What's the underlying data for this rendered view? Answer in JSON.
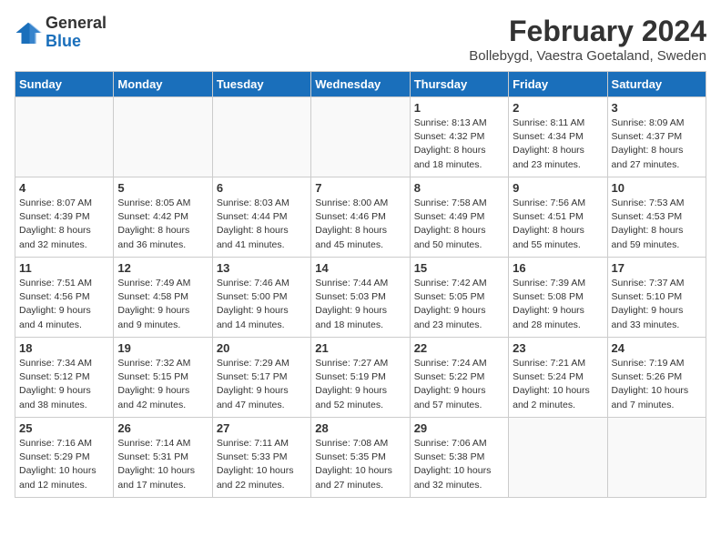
{
  "logo": {
    "general": "General",
    "blue": "Blue"
  },
  "header": {
    "month": "February 2024",
    "location": "Bollebygd, Vaestra Goetaland, Sweden"
  },
  "weekdays": [
    "Sunday",
    "Monday",
    "Tuesday",
    "Wednesday",
    "Thursday",
    "Friday",
    "Saturday"
  ],
  "weeks": [
    [
      {
        "day": "",
        "info": ""
      },
      {
        "day": "",
        "info": ""
      },
      {
        "day": "",
        "info": ""
      },
      {
        "day": "",
        "info": ""
      },
      {
        "day": "1",
        "info": "Sunrise: 8:13 AM\nSunset: 4:32 PM\nDaylight: 8 hours\nand 18 minutes."
      },
      {
        "day": "2",
        "info": "Sunrise: 8:11 AM\nSunset: 4:34 PM\nDaylight: 8 hours\nand 23 minutes."
      },
      {
        "day": "3",
        "info": "Sunrise: 8:09 AM\nSunset: 4:37 PM\nDaylight: 8 hours\nand 27 minutes."
      }
    ],
    [
      {
        "day": "4",
        "info": "Sunrise: 8:07 AM\nSunset: 4:39 PM\nDaylight: 8 hours\nand 32 minutes."
      },
      {
        "day": "5",
        "info": "Sunrise: 8:05 AM\nSunset: 4:42 PM\nDaylight: 8 hours\nand 36 minutes."
      },
      {
        "day": "6",
        "info": "Sunrise: 8:03 AM\nSunset: 4:44 PM\nDaylight: 8 hours\nand 41 minutes."
      },
      {
        "day": "7",
        "info": "Sunrise: 8:00 AM\nSunset: 4:46 PM\nDaylight: 8 hours\nand 45 minutes."
      },
      {
        "day": "8",
        "info": "Sunrise: 7:58 AM\nSunset: 4:49 PM\nDaylight: 8 hours\nand 50 minutes."
      },
      {
        "day": "9",
        "info": "Sunrise: 7:56 AM\nSunset: 4:51 PM\nDaylight: 8 hours\nand 55 minutes."
      },
      {
        "day": "10",
        "info": "Sunrise: 7:53 AM\nSunset: 4:53 PM\nDaylight: 8 hours\nand 59 minutes."
      }
    ],
    [
      {
        "day": "11",
        "info": "Sunrise: 7:51 AM\nSunset: 4:56 PM\nDaylight: 9 hours\nand 4 minutes."
      },
      {
        "day": "12",
        "info": "Sunrise: 7:49 AM\nSunset: 4:58 PM\nDaylight: 9 hours\nand 9 minutes."
      },
      {
        "day": "13",
        "info": "Sunrise: 7:46 AM\nSunset: 5:00 PM\nDaylight: 9 hours\nand 14 minutes."
      },
      {
        "day": "14",
        "info": "Sunrise: 7:44 AM\nSunset: 5:03 PM\nDaylight: 9 hours\nand 18 minutes."
      },
      {
        "day": "15",
        "info": "Sunrise: 7:42 AM\nSunset: 5:05 PM\nDaylight: 9 hours\nand 23 minutes."
      },
      {
        "day": "16",
        "info": "Sunrise: 7:39 AM\nSunset: 5:08 PM\nDaylight: 9 hours\nand 28 minutes."
      },
      {
        "day": "17",
        "info": "Sunrise: 7:37 AM\nSunset: 5:10 PM\nDaylight: 9 hours\nand 33 minutes."
      }
    ],
    [
      {
        "day": "18",
        "info": "Sunrise: 7:34 AM\nSunset: 5:12 PM\nDaylight: 9 hours\nand 38 minutes."
      },
      {
        "day": "19",
        "info": "Sunrise: 7:32 AM\nSunset: 5:15 PM\nDaylight: 9 hours\nand 42 minutes."
      },
      {
        "day": "20",
        "info": "Sunrise: 7:29 AM\nSunset: 5:17 PM\nDaylight: 9 hours\nand 47 minutes."
      },
      {
        "day": "21",
        "info": "Sunrise: 7:27 AM\nSunset: 5:19 PM\nDaylight: 9 hours\nand 52 minutes."
      },
      {
        "day": "22",
        "info": "Sunrise: 7:24 AM\nSunset: 5:22 PM\nDaylight: 9 hours\nand 57 minutes."
      },
      {
        "day": "23",
        "info": "Sunrise: 7:21 AM\nSunset: 5:24 PM\nDaylight: 10 hours\nand 2 minutes."
      },
      {
        "day": "24",
        "info": "Sunrise: 7:19 AM\nSunset: 5:26 PM\nDaylight: 10 hours\nand 7 minutes."
      }
    ],
    [
      {
        "day": "25",
        "info": "Sunrise: 7:16 AM\nSunset: 5:29 PM\nDaylight: 10 hours\nand 12 minutes."
      },
      {
        "day": "26",
        "info": "Sunrise: 7:14 AM\nSunset: 5:31 PM\nDaylight: 10 hours\nand 17 minutes."
      },
      {
        "day": "27",
        "info": "Sunrise: 7:11 AM\nSunset: 5:33 PM\nDaylight: 10 hours\nand 22 minutes."
      },
      {
        "day": "28",
        "info": "Sunrise: 7:08 AM\nSunset: 5:35 PM\nDaylight: 10 hours\nand 27 minutes."
      },
      {
        "day": "29",
        "info": "Sunrise: 7:06 AM\nSunset: 5:38 PM\nDaylight: 10 hours\nand 32 minutes."
      },
      {
        "day": "",
        "info": ""
      },
      {
        "day": "",
        "info": ""
      }
    ]
  ]
}
